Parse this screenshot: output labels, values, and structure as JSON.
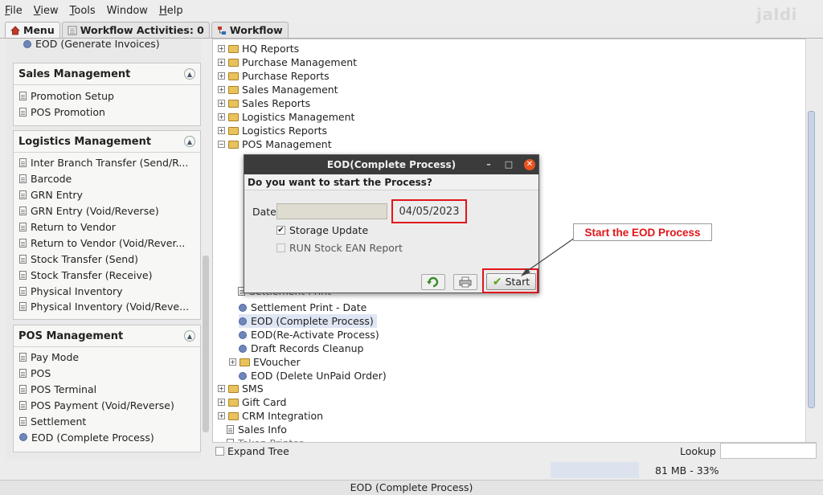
{
  "menubar": {
    "items": [
      {
        "mnemonic": "F",
        "rest": "ile"
      },
      {
        "mnemonic": "V",
        "rest": "iew"
      },
      {
        "mnemonic": "T",
        "rest": "ools"
      },
      {
        "mnemonic": "",
        "rest": "Window"
      },
      {
        "mnemonic": "H",
        "rest": "elp"
      }
    ],
    "brand": "jaldi"
  },
  "tabs": [
    {
      "label": "Menu",
      "active": true
    },
    {
      "label": "Workflow Activities: 0",
      "active": false
    },
    {
      "label": "Workflow",
      "active": false
    }
  ],
  "left_panel": {
    "partial_item": "EOD (Generate Invoices)",
    "sections": [
      {
        "title": "Sales Management",
        "items": [
          {
            "label": "Promotion Setup",
            "icon": "document-icon"
          },
          {
            "label": "POS Promotion",
            "icon": "document-icon"
          }
        ]
      },
      {
        "title": "Logistics Management",
        "items": [
          {
            "label": "Inter Branch Transfer (Send/R...",
            "icon": "document-icon"
          },
          {
            "label": "Barcode",
            "icon": "document-icon"
          },
          {
            "label": "GRN Entry",
            "icon": "document-icon"
          },
          {
            "label": "GRN Entry (Void/Reverse)",
            "icon": "document-icon"
          },
          {
            "label": "Return to Vendor",
            "icon": "document-icon"
          },
          {
            "label": "Return to Vendor (Void/Rever...",
            "icon": "document-icon"
          },
          {
            "label": "Stock Transfer (Send)",
            "icon": "document-icon"
          },
          {
            "label": "Stock Transfer (Receive)",
            "icon": "document-icon"
          },
          {
            "label": "Physical Inventory",
            "icon": "document-icon"
          },
          {
            "label": "Physical Inventory (Void/Reve...",
            "icon": "document-icon"
          }
        ]
      },
      {
        "title": "POS Management",
        "items": [
          {
            "label": "Pay Mode",
            "icon": "document-icon"
          },
          {
            "label": "POS",
            "icon": "document-icon"
          },
          {
            "label": "POS Terminal",
            "icon": "document-icon"
          },
          {
            "label": "POS Payment (Void/Reverse)",
            "icon": "document-icon"
          },
          {
            "label": "Settlement",
            "icon": "document-icon"
          },
          {
            "label": "EOD (Complete Process)",
            "icon": "gear-icon"
          }
        ]
      }
    ]
  },
  "tree": {
    "nodes": [
      {
        "label": "HQ Reports",
        "type": "folder",
        "expander": "+"
      },
      {
        "label": "Purchase Management",
        "type": "folder",
        "expander": "+"
      },
      {
        "label": "Purchase Reports",
        "type": "folder",
        "expander": "+"
      },
      {
        "label": "Sales Management",
        "type": "folder",
        "expander": "+"
      },
      {
        "label": "Sales Reports",
        "type": "folder",
        "expander": "+"
      },
      {
        "label": "Logistics Management",
        "type": "folder",
        "expander": "+"
      },
      {
        "label": "Logistics Reports",
        "type": "folder",
        "expander": "+"
      },
      {
        "label": "POS Management",
        "type": "folder",
        "expander": "−"
      }
    ],
    "children": [
      {
        "label": "Settlement Print",
        "type": "doc",
        "partial": true
      },
      {
        "label": "Settlement Print - Date",
        "type": "gear"
      },
      {
        "label": "EOD (Complete Process)",
        "type": "gear",
        "selected": true
      },
      {
        "label": "EOD(Re-Activate Process)",
        "type": "gear"
      },
      {
        "label": "Draft Records Cleanup",
        "type": "gear"
      },
      {
        "label": "EVoucher",
        "type": "folder",
        "expander": "+"
      },
      {
        "label": "EOD (Delete UnPaid Order)",
        "type": "gear"
      }
    ],
    "nodes_after": [
      {
        "label": "SMS",
        "type": "folder",
        "expander": "+"
      },
      {
        "label": "Gift Card",
        "type": "folder",
        "expander": "+"
      },
      {
        "label": "CRM Integration",
        "type": "folder",
        "expander": "+"
      },
      {
        "label": "Sales Info",
        "type": "doc"
      },
      {
        "label": "Token Printer",
        "type": "doc",
        "partial": true
      }
    ]
  },
  "bottombar": {
    "expand_tree_label": "Expand Tree",
    "lookup_label": "Lookup",
    "lookup_value": ""
  },
  "status": {
    "memory": "81 MB - 33%",
    "footer": "EOD (Complete Process)"
  },
  "dialog": {
    "title": "EOD(Complete Process)",
    "prompt": "Do you want to start the Process?",
    "date_label": "Date",
    "date_value": "04/05/2023",
    "options": [
      {
        "label": "Storage Update",
        "checked": true,
        "enabled": true
      },
      {
        "label": "RUN Stock EAN Report",
        "checked": false,
        "enabled": false
      }
    ],
    "start_label": "Start"
  },
  "annotation": {
    "callout": "Start the EOD Process"
  },
  "colors": {
    "highlight": "#e0161a",
    "titlebar": "#3b3b3b",
    "close": "#e95420",
    "selection": "#dfe6f3"
  }
}
